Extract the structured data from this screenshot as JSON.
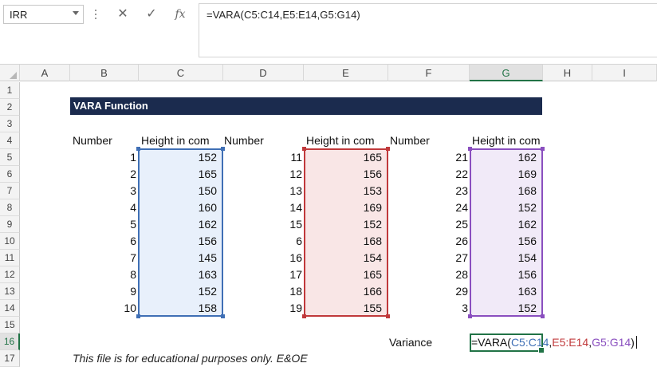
{
  "formula_bar": {
    "name_box": "IRR",
    "cancel_glyph": "✕",
    "enter_glyph": "✓",
    "fx_label": "fx",
    "formula": "=VARA(C5:C14,E5:E14,G5:G14)"
  },
  "columns": [
    "A",
    "B",
    "C",
    "D",
    "E",
    "F",
    "G",
    "H",
    "I"
  ],
  "selected_column": "G",
  "rows": [
    "1",
    "2",
    "3",
    "4",
    "5",
    "6",
    "7",
    "8",
    "9",
    "10",
    "11",
    "12",
    "13",
    "14",
    "15",
    "16",
    "17"
  ],
  "selected_row": "16",
  "sheet": {
    "title": "VARA Function",
    "headers": {
      "b": "Number",
      "c": "Height in com",
      "d": "Number",
      "e": "Height in com",
      "f": "Number",
      "g": "Height in com"
    },
    "table": [
      {
        "b": "1",
        "c": "152",
        "d": "11",
        "e": "165",
        "f": "21",
        "g": "162"
      },
      {
        "b": "2",
        "c": "165",
        "d": "12",
        "e": "156",
        "f": "22",
        "g": "169"
      },
      {
        "b": "3",
        "c": "150",
        "d": "13",
        "e": "153",
        "f": "23",
        "g": "168"
      },
      {
        "b": "4",
        "c": "160",
        "d": "14",
        "e": "169",
        "f": "24",
        "g": "152"
      },
      {
        "b": "5",
        "c": "162",
        "d": "15",
        "e": "152",
        "f": "25",
        "g": "162"
      },
      {
        "b": "6",
        "c": "156",
        "d": "6",
        "e": "168",
        "f": "26",
        "g": "156"
      },
      {
        "b": "7",
        "c": "145",
        "d": "16",
        "e": "154",
        "f": "27",
        "g": "154"
      },
      {
        "b": "8",
        "c": "163",
        "d": "17",
        "e": "165",
        "f": "28",
        "g": "156"
      },
      {
        "b": "9",
        "c": "152",
        "d": "18",
        "e": "166",
        "f": "29",
        "g": "163"
      },
      {
        "b": "10",
        "c": "158",
        "d": "19",
        "e": "155",
        "f": "3",
        "g": "152"
      }
    ],
    "variance_label": "Variance",
    "active_formula": {
      "prefix": "=VARA(",
      "ref1": "C5:C14",
      "sep1": ",",
      "ref2": "E5:E14",
      "sep2": ",",
      "ref3": "G5:G14",
      "suffix": ")"
    },
    "footer_note": "This file is for educational purposes only. E&OE"
  },
  "colors": {
    "title_bg": "#1b2b4e",
    "range_blue": "#3f6fb5",
    "range_blue_fill": "#e8f0fb",
    "range_red": "#c0393b",
    "range_red_fill": "#f9e6e6",
    "range_purple": "#8a4fbf",
    "range_purple_fill": "#f1eaf8",
    "excel_green": "#217346"
  }
}
